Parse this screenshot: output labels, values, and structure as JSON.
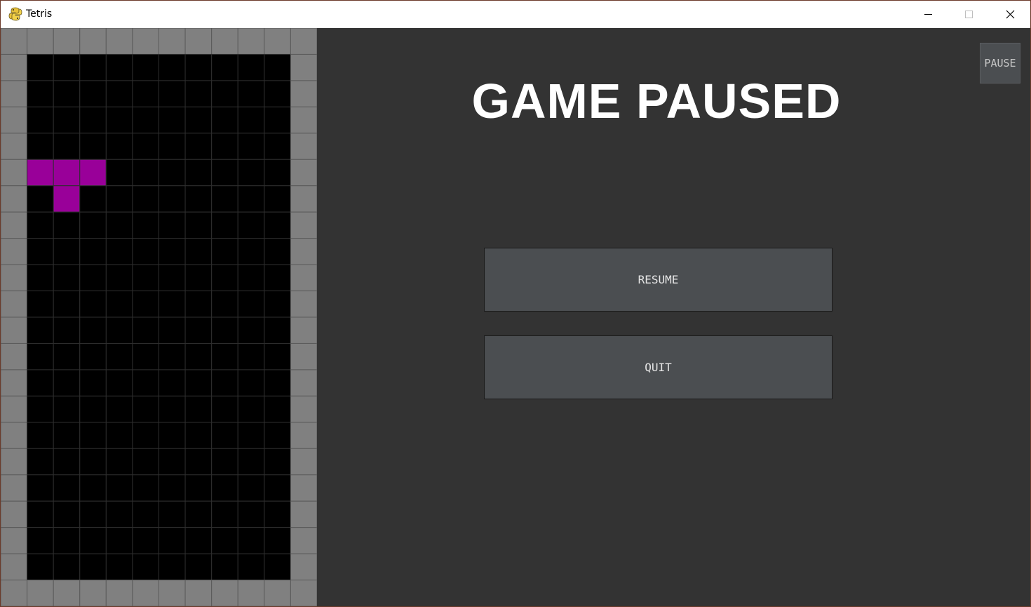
{
  "window": {
    "title": "Tetris",
    "app_icon": "python-snake-icon",
    "controls": [
      "minimize-icon",
      "maximize-icon",
      "close-icon"
    ]
  },
  "overlay": {
    "title": "GAME PAUSED",
    "resume_label": "RESUME",
    "quit_label": "QUIT"
  },
  "pause_button": {
    "label": "PAUSE"
  },
  "board": {
    "columns": 10,
    "rows": 20,
    "colors": {
      "background": "#000000",
      "grid": "#2e2e2e",
      "border": "#808080",
      "border_grid": "#5a5a5a",
      "piece_t": "#990099"
    },
    "active_piece": {
      "type": "T",
      "cells": [
        [
          0,
          4
        ],
        [
          1,
          4
        ],
        [
          2,
          4
        ],
        [
          1,
          5
        ]
      ]
    }
  },
  "colors": {
    "panel_bg": "#333333",
    "button_bg": "#4b4e51",
    "title_text": "#ffffff"
  }
}
